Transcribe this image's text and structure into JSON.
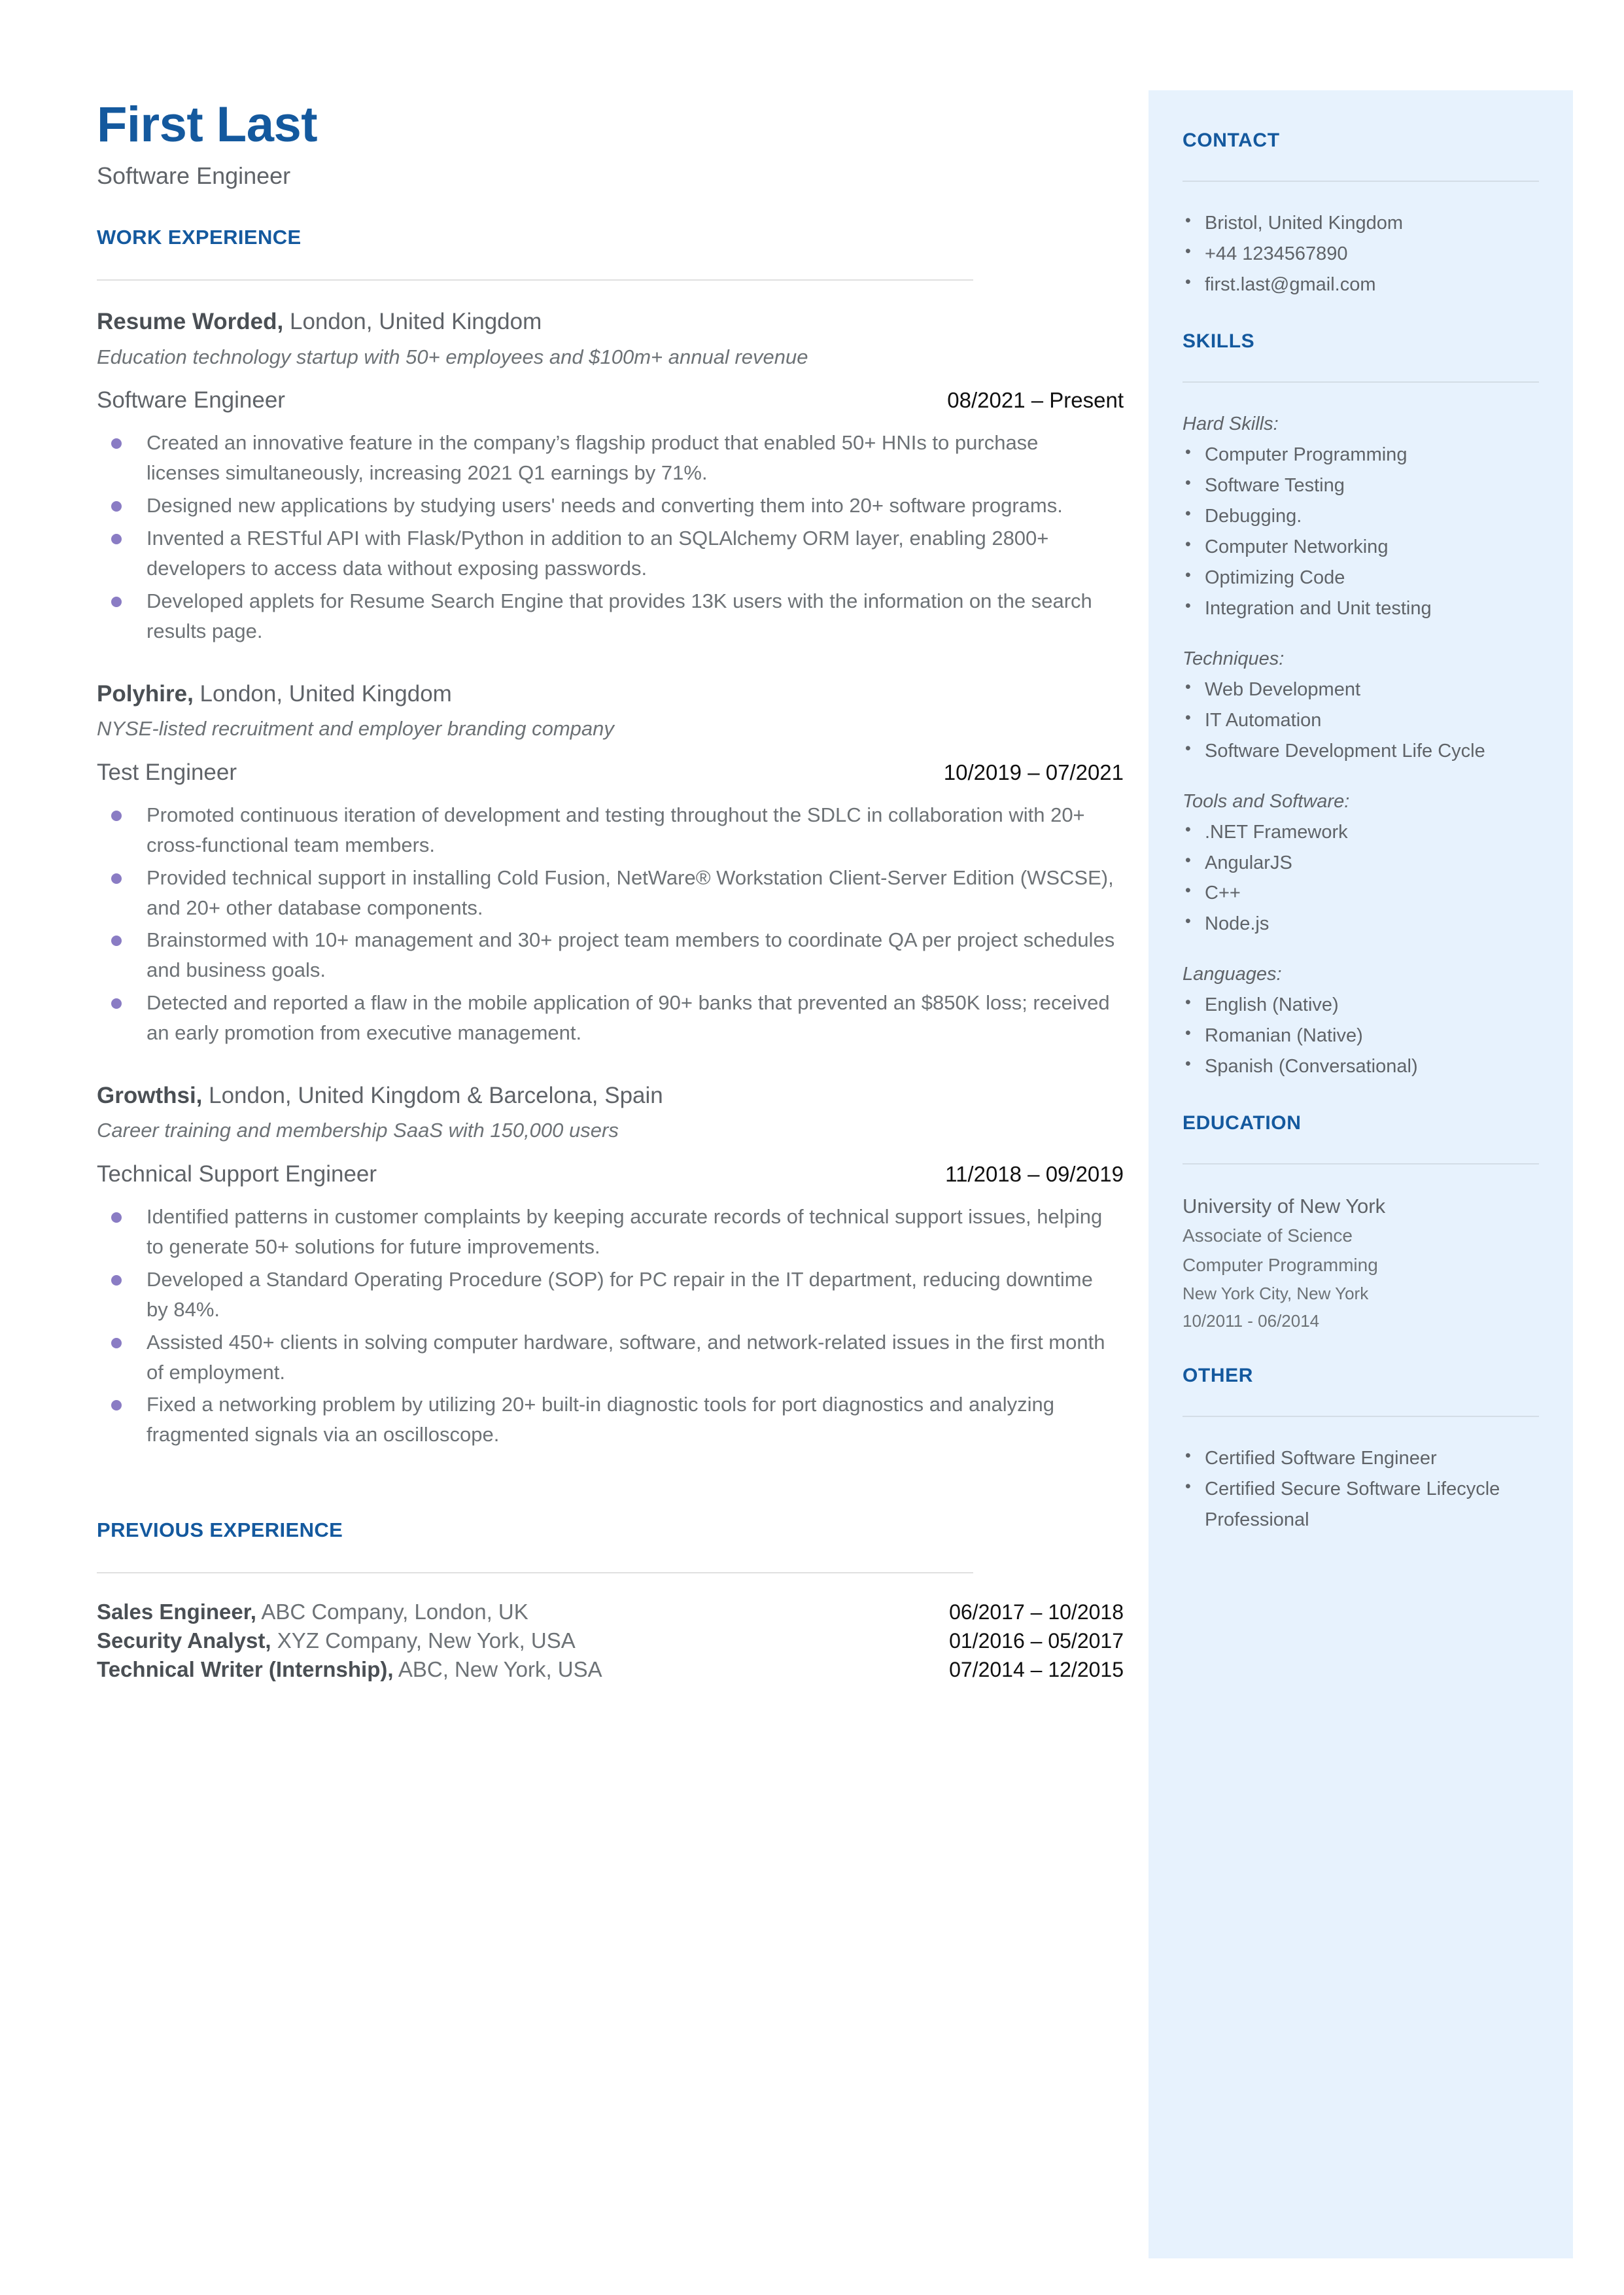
{
  "header": {
    "name": "First Last",
    "title": "Software Engineer"
  },
  "sections": {
    "work_experience": "WORK EXPERIENCE",
    "previous_experience": "PREVIOUS EXPERIENCE",
    "contact": "CONTACT",
    "skills": "SKILLS",
    "education": "EDUCATION",
    "other": "OTHER"
  },
  "jobs": [
    {
      "company": "Resume Worded,",
      "location": " London, United Kingdom",
      "description": "Education technology startup with 50+ employees and $100m+ annual revenue",
      "role": "Software Engineer",
      "dates": "08/2021 – Present",
      "bullets": [
        "Created an innovative feature in the company’s flagship product that enabled 50+ HNIs to purchase licenses simultaneously, increasing 2021 Q1 earnings by 71%.",
        "Designed new applications by studying users' needs and converting them into 20+ software programs.",
        "Invented a RESTful API with Flask/Python in addition to an SQLAlchemy ORM layer, enabling 2800+ developers to access data without exposing passwords.",
        "Developed applets for Resume Search Engine that provides 13K users with the information on the search results page."
      ]
    },
    {
      "company": "Polyhire,",
      "location": " London, United Kingdom",
      "description": "NYSE-listed recruitment and employer branding company",
      "role": "Test Engineer",
      "dates": "10/2019 – 07/2021",
      "bullets": [
        "Promoted continuous iteration of development and testing throughout the SDLC in collaboration with 20+ cross-functional team members.",
        "Provided technical support in installing Cold Fusion, NetWare® Workstation Client-Server Edition (WSCSE), and 20+ other database components.",
        "Brainstormed with 10+ management and 30+ project team members to coordinate QA per project schedules and business goals.",
        "Detected and reported a flaw in the mobile application of 90+ banks that prevented an $850K loss; received an early promotion from executive management."
      ]
    },
    {
      "company": "Growthsi,",
      "location": " London, United Kingdom & Barcelona, Spain",
      "description": "Career training and membership SaaS with 150,000 users",
      "role": "Technical Support Engineer",
      "dates": "11/2018 – 09/2019",
      "bullets": [
        "Identified patterns in customer complaints by keeping accurate records of technical support issues, helping to generate 50+ solutions for future improvements.",
        "Developed a Standard Operating Procedure (SOP) for PC repair in the IT department, reducing downtime by 84%.",
        "Assisted 450+ clients in solving computer hardware, software, and network-related issues in the first month of employment.",
        "Fixed a networking problem by utilizing 20+ built-in diagnostic tools for port diagnostics and analyzing fragmented signals via an oscilloscope."
      ]
    }
  ],
  "previous_experience": [
    {
      "role": "Sales Engineer,",
      "detail": " ABC Company, London, UK",
      "dates": "06/2017 – 10/2018"
    },
    {
      "role": "Security Analyst,",
      "detail": " XYZ Company, New York, USA",
      "dates": "01/2016 – 05/2017"
    },
    {
      "role": "Technical Writer (Internship),",
      "detail": " ABC, New York, USA",
      "dates": "07/2014 – 12/2015"
    }
  ],
  "contact": {
    "items": [
      " Bristol, United Kingdom",
      "+44 1234567890",
      "first.last@gmail.com"
    ]
  },
  "skills": {
    "groups": [
      {
        "label": "Hard Skills:",
        "items": [
          "Computer Programming",
          "Software Testing",
          "Debugging.",
          "Computer Networking",
          "Optimizing Code",
          "Integration and Unit testing"
        ]
      },
      {
        "label": "Techniques:",
        "items": [
          "Web Development",
          "IT Automation",
          "Software Development Life Cycle"
        ]
      },
      {
        "label": "Tools and Software:",
        "items": [
          ".NET Framework",
          "AngularJS",
          "C++",
          "Node.js"
        ]
      },
      {
        "label": "Languages:",
        "items": [
          "English (Native)",
          "Romanian (Native)",
          "Spanish (Conversational)"
        ]
      }
    ]
  },
  "education": {
    "school": "University of New York",
    "degree": "Associate of Science",
    "field": "Computer Programming",
    "location": "New York City, New York",
    "dates": "10/2011 - 06/2014"
  },
  "other": {
    "items": [
      "Certified Software Engineer",
      "Certified Secure Software Lifecycle Professional"
    ]
  },
  "colors": {
    "accent": "#14599e",
    "sidebar_bg": "#e7f2fd",
    "bullet": "#8a7cc4",
    "body_text": "#6d7276"
  }
}
